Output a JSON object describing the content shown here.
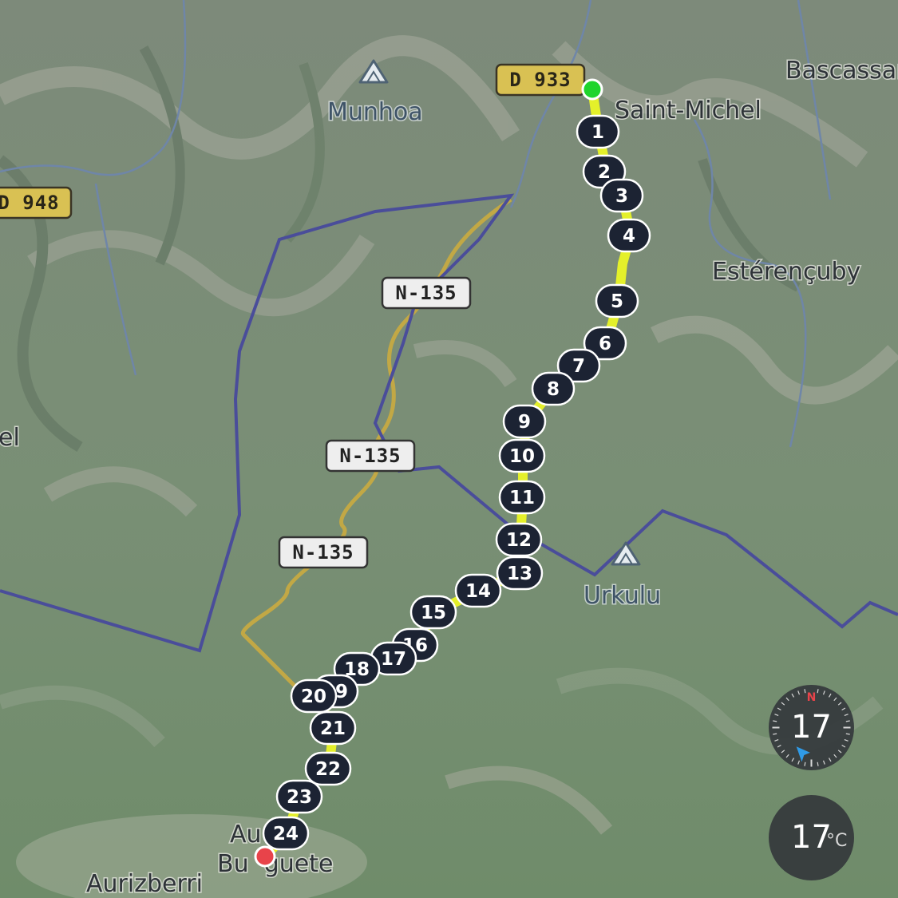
{
  "map": {
    "colors": {
      "terrain": "#7a8e76",
      "border": "#4a4d9a",
      "route": "#e4f02a",
      "road_secondary": "#c2a845",
      "start": "#1fd42c",
      "end": "#e8434a",
      "marker_bg": "#1c2333"
    },
    "places": [
      {
        "id": "bascassan",
        "label": "Bascassan"
      },
      {
        "id": "saint-michel",
        "label": "Saint-Michel"
      },
      {
        "id": "esterencuby",
        "label": "Estérençuby"
      },
      {
        "id": "el",
        "label": "el"
      },
      {
        "id": "auritz",
        "label": "Au    /"
      },
      {
        "id": "burguete",
        "label": "Bu  guete"
      },
      {
        "id": "aurizberri",
        "label": "Aurizberri"
      }
    ],
    "peaks": [
      {
        "id": "munhoa",
        "label": "Munhoa",
        "icon": "mountain-icon"
      },
      {
        "id": "urkulu",
        "label": "Urkulu",
        "icon": "mountain-icon"
      }
    ],
    "road_shields": [
      {
        "id": "d933",
        "label": "D 933",
        "style": "yellow"
      },
      {
        "id": "d948",
        "label": "D 948",
        "style": "yellow"
      },
      {
        "id": "n135-a",
        "label": "N-135",
        "style": "white"
      },
      {
        "id": "n135-b",
        "label": "N-135",
        "style": "white"
      },
      {
        "id": "n135-c",
        "label": "N-135",
        "style": "white"
      }
    ],
    "route_markers": [
      "1",
      "2",
      "3",
      "4",
      "5",
      "6",
      "7",
      "8",
      "9",
      "10",
      "11",
      "12",
      "13",
      "14",
      "15",
      "16",
      "17",
      "18",
      "19",
      "20",
      "21",
      "22",
      "23",
      "24"
    ]
  },
  "compass": {
    "value": "17",
    "north_label": "N",
    "icon": "compass-icon"
  },
  "weather": {
    "temperature": "17",
    "unit": "°C"
  }
}
